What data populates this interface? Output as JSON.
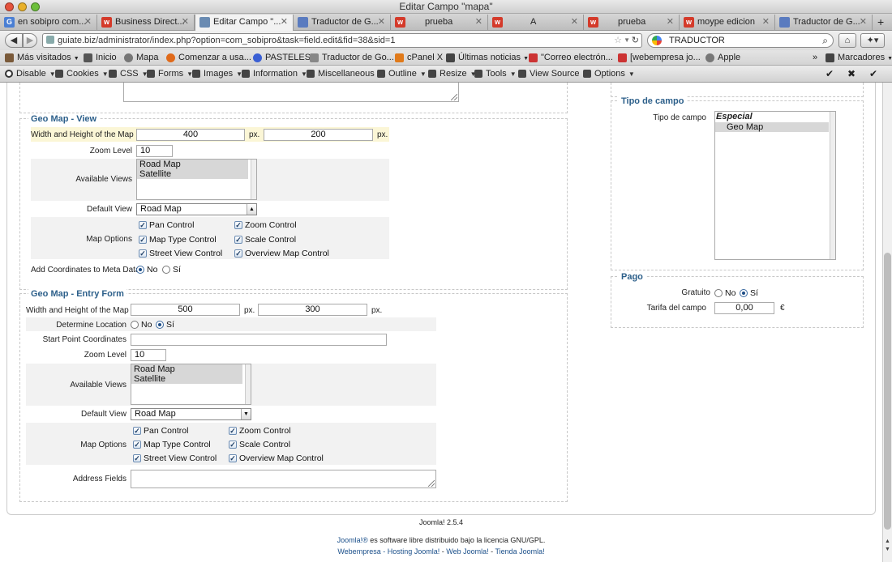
{
  "window": {
    "title": "Editar Campo \"mapa\""
  },
  "tabs": [
    {
      "label": "en sobipro com...",
      "fav": "G",
      "color": "#4a7fd4"
    },
    {
      "label": "Business Direct...",
      "fav": "w",
      "color": "#d43a2a"
    },
    {
      "label": "Editar Campo \"...",
      "fav": "",
      "color": "#6a8bb2"
    },
    {
      "label": "Traductor de G...",
      "fav": "",
      "color": "#5a7bbf"
    },
    {
      "label": "prueba",
      "fav": "w",
      "color": "#d43a2a"
    },
    {
      "label": "A",
      "fav": "w",
      "color": "#d43a2a"
    },
    {
      "label": "prueba",
      "fav": "w",
      "color": "#d43a2a"
    },
    {
      "label": "moype edicion",
      "fav": "w",
      "color": "#d43a2a"
    },
    {
      "label": "Traductor de G...",
      "fav": "",
      "color": "#5a7bbf"
    }
  ],
  "nav": {
    "url": "guiate.biz/administrator/index.php?option=com_sobipro&task=field.edit&fid=38&sid=1",
    "search": "TRADUCTOR"
  },
  "bookmarks": [
    {
      "label": "Más visitados",
      "color": "#7a5a3a",
      "arrow": true
    },
    {
      "label": "Inicio",
      "color": "#555"
    },
    {
      "label": "Mapa",
      "color": "#555"
    },
    {
      "label": "Comenzar a usa...",
      "color": "#e06a1a"
    },
    {
      "label": "PASTELES",
      "color": "#3a5fd4"
    },
    {
      "label": "Traductor de Go...",
      "color": "#888"
    },
    {
      "label": "cPanel X",
      "color": "#e07a1a"
    },
    {
      "label": "Últimas noticias",
      "color": "#444",
      "arrow": true
    },
    {
      "label": "\"Correo electrón...",
      "color": "#c33"
    },
    {
      "label": "[webempresa jo...",
      "color": "#c33"
    },
    {
      "label": "Apple",
      "color": "#777"
    },
    {
      "label": "Marcadores",
      "color": "#444",
      "arrow": true
    }
  ],
  "devtools": [
    {
      "label": "Disable"
    },
    {
      "label": "Cookies"
    },
    {
      "label": "CSS"
    },
    {
      "label": "Forms"
    },
    {
      "label": "Images"
    },
    {
      "label": "Information"
    },
    {
      "label": "Miscellaneous"
    },
    {
      "label": "Outline"
    },
    {
      "label": "Resize"
    },
    {
      "label": "Tools"
    },
    {
      "label": "View Source"
    },
    {
      "label": "Options"
    }
  ],
  "geo_view": {
    "legend": "Geo Map - View",
    "size_label": "Width and Height of the Map",
    "width": "400",
    "height": "200",
    "unit": "px.",
    "zoom_label": "Zoom Level",
    "zoom": "10",
    "views_label": "Available Views",
    "views": [
      "Road Map",
      "Satellite"
    ],
    "default_label": "Default View",
    "default_value": "Road Map",
    "options_label": "Map Options",
    "options": [
      "Pan Control",
      "Zoom Control",
      "Map Type Control",
      "Scale Control",
      "Street View Control",
      "Overview Map Control"
    ],
    "meta_label": "Add Coordinates to Meta Data",
    "no": "No",
    "yes": "Sí"
  },
  "geo_entry": {
    "legend": "Geo Map - Entry Form",
    "size_label": "Width and Height of the Map",
    "width": "500",
    "height": "300",
    "unit": "px.",
    "locate_label": "Determine Location",
    "no": "No",
    "yes": "Sí",
    "start_label": "Start Point Coordinates",
    "start_value": "",
    "zoom_label": "Zoom Level",
    "zoom": "10",
    "views_label": "Available Views",
    "views": [
      "Road Map",
      "Satellite"
    ],
    "default_label": "Default View",
    "default_value": "Road Map",
    "options_label": "Map Options",
    "options": [
      "Pan Control",
      "Zoom Control",
      "Map Type Control",
      "Scale Control",
      "Street View Control",
      "Overview Map Control"
    ],
    "address_label": "Address Fields"
  },
  "field_type": {
    "legend": "Tipo de campo",
    "label": "Tipo de campo",
    "group": "Especial",
    "option": "Geo Map"
  },
  "pago": {
    "legend": "Pago",
    "free_label": "Gratuito",
    "no": "No",
    "yes": "Sí",
    "fee_label": "Tarifa del campo",
    "fee": "0,00",
    "currency": "€"
  },
  "footer": {
    "version": "Joomla! 2.5.4",
    "license_link": "Joomla!®",
    "license_text": " es software libre distribuido bajo la licencia GNU/GPL.",
    "links": [
      "Webempresa - Hosting Joomla!",
      "Web Joomla!",
      "Tienda Joomla!"
    ],
    "sep": " - "
  }
}
